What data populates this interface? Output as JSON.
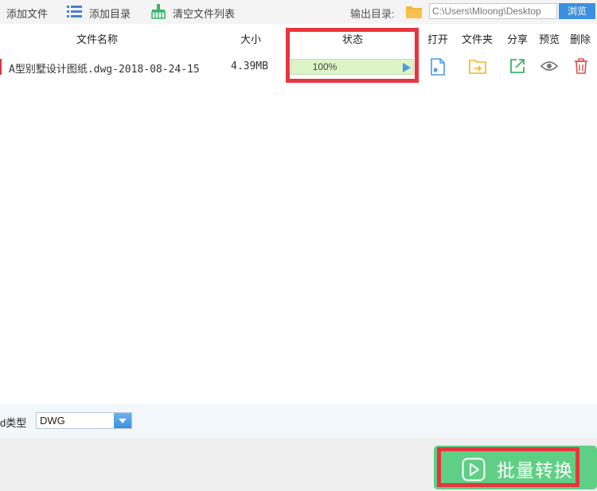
{
  "toolbar": {
    "add_file": "添加文件",
    "add_directory": "添加目录",
    "clear_list": "清空文件列表",
    "output_dir_label": "输出目录:",
    "output_dir_value": "C:\\Users\\Mloong\\Desktop",
    "browse": "浏览"
  },
  "table": {
    "headers": {
      "name": "文件名称",
      "size": "大小",
      "status": "状态",
      "open": "打开",
      "folder": "文件夹",
      "share": "分享",
      "preview": "预览",
      "delete": "删除"
    },
    "rows": [
      {
        "name": "A型别墅设计图纸.dwg-2018-08-24-15",
        "size": "4.39MB",
        "progress": 1.0,
        "progress_text": "100%"
      }
    ]
  },
  "format": {
    "label": "d类型",
    "selected": "DWG"
  },
  "convert": {
    "label": "批量转换"
  },
  "colors": {
    "accent_blue": "#3b8fe0",
    "green": "#5fcf85",
    "highlight_red": "#e8353d",
    "progress_green": "#e4f7d2",
    "open_icon": "#4a9be0",
    "folder_icon": "#f0b428",
    "share_icon": "#3ab56a",
    "preview_icon": "#777777",
    "delete_icon": "#e04b4b"
  },
  "icons": {
    "add_file": "none",
    "add_directory": "list-icon",
    "clear_list": "broom-icon",
    "output_folder": "folder-icon",
    "open": "file-open-icon",
    "folder": "folder-arrow-icon",
    "share": "share-icon",
    "preview": "eye-icon",
    "delete": "trash-icon",
    "convert": "play-icon"
  }
}
